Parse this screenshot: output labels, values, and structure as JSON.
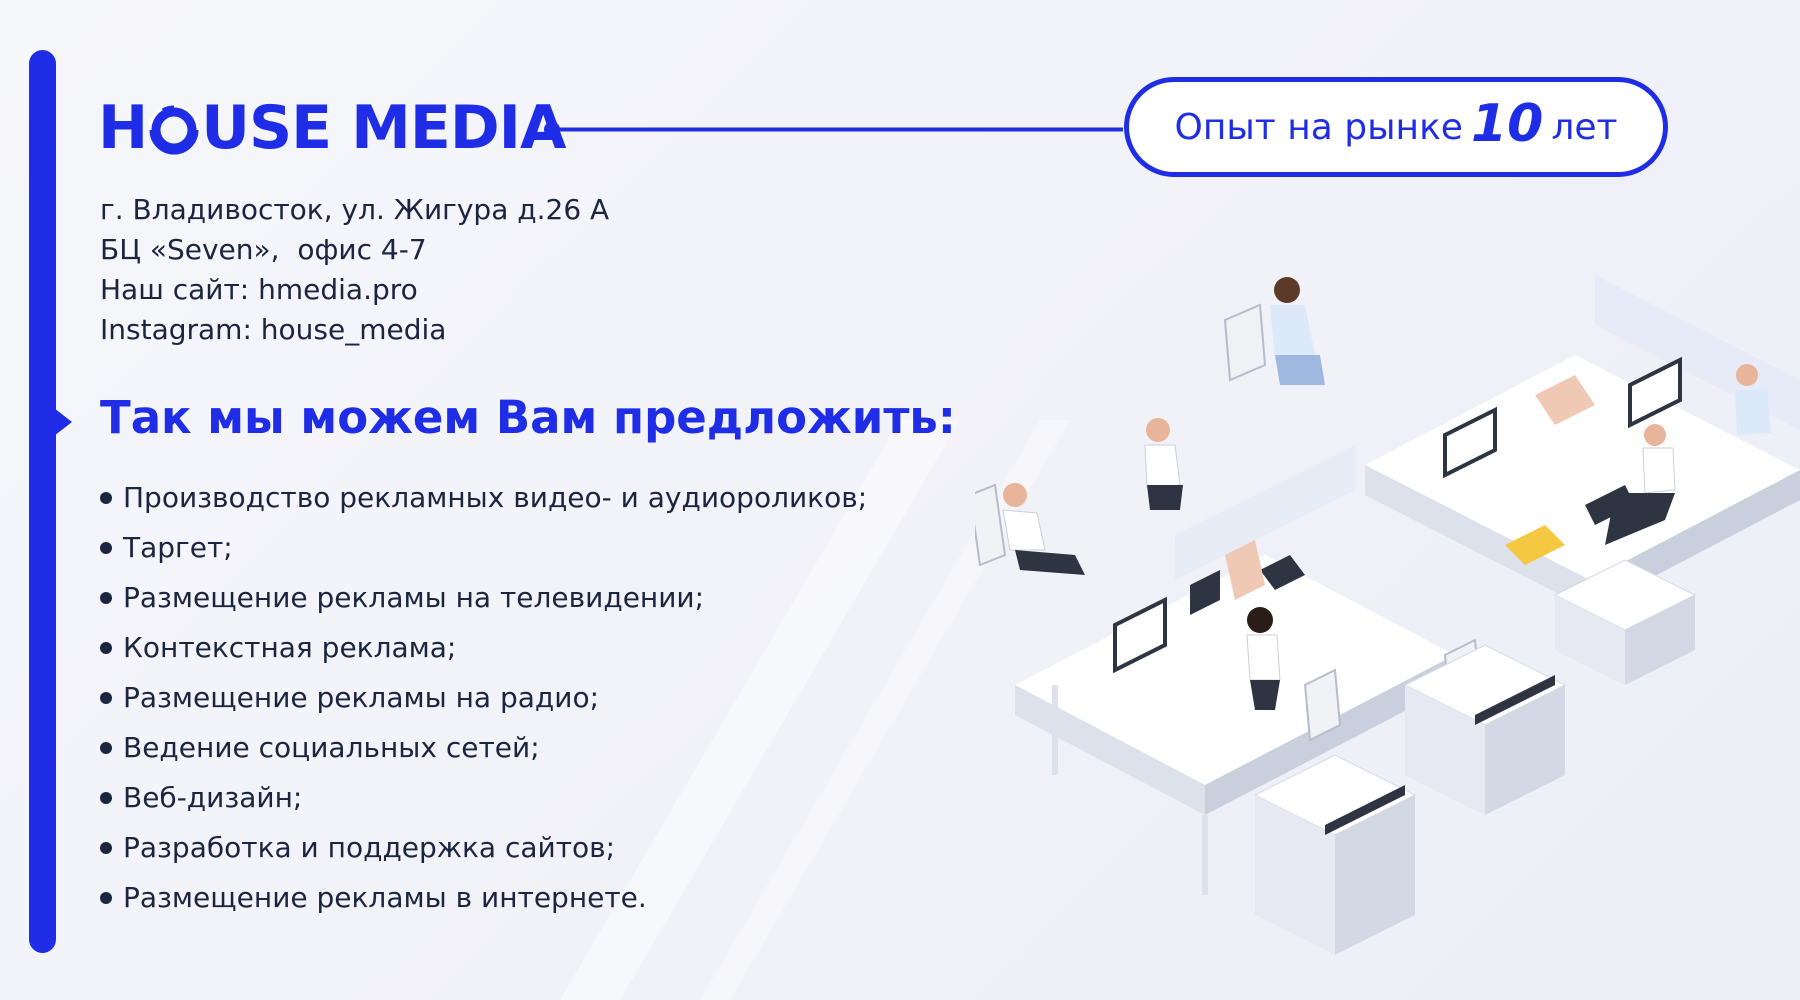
{
  "brand": {
    "logo_text_before_o": "H",
    "logo_text_after_o": "USE",
    "logo_text_second": "MEDIA",
    "color": "#1f2de6"
  },
  "badge": {
    "prefix": "Опыт на рынке",
    "number": "10",
    "suffix": "лет"
  },
  "contacts": [
    "г. Владивосток, ул. Жигура д.26 А",
    "БЦ «Seven»,  офис 4-7",
    "Наш сайт: hmedia.pro",
    "Instagram: house_media"
  ],
  "heading": "Так мы можем Вам предложить:",
  "services": [
    "Производство рекламных видео- и аудиороликов;",
    "Таргет;",
    "Размещение рекламы на телевидении;",
    "Контекстная реклама;",
    "Размещение рекламы на радио;",
    "Ведение социальных сетей;",
    "Веб-дизайн;",
    "Разработка и поддержка сайтов;",
    "Размещение рекламы в интернете."
  ],
  "colors": {
    "accent": "#1f2de6",
    "text": "#1c2540",
    "background": "#f4f5fa"
  },
  "illustration": {
    "icon": "isometric-office-illustration"
  }
}
